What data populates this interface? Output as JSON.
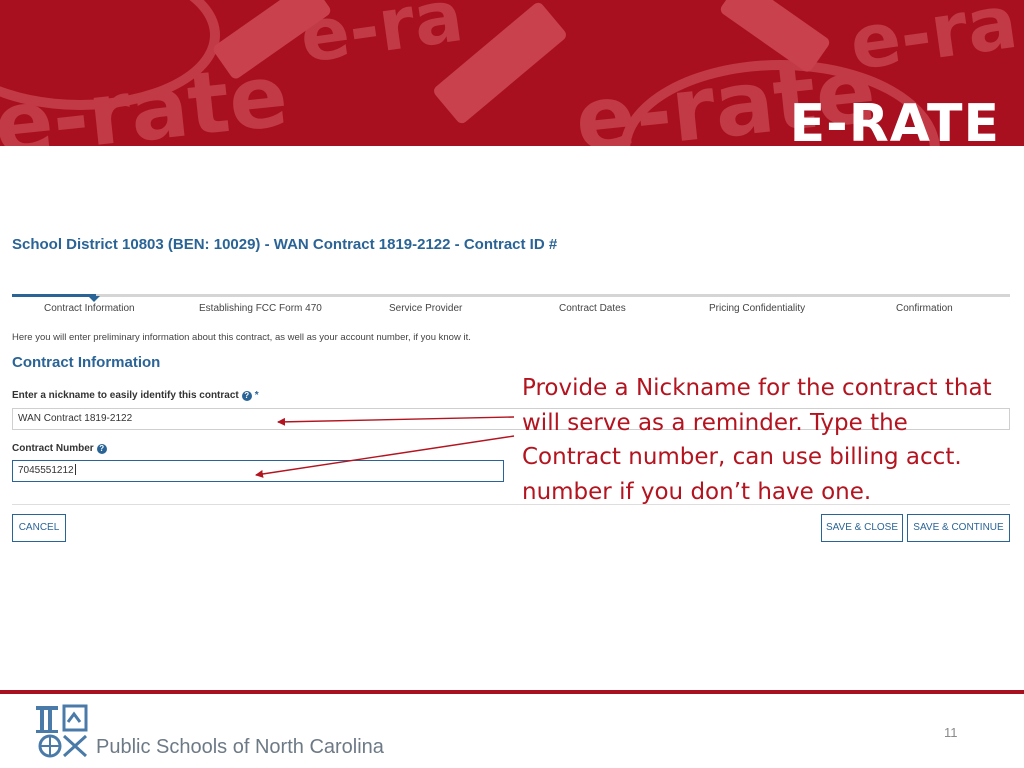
{
  "banner": {
    "brand": "E-RATE",
    "watermarks": [
      "e-rate",
      "e-rate",
      "e-rate",
      "e-ra",
      "e-ra"
    ],
    "colors": {
      "background": "#a8101f",
      "watermark": "#c23a45"
    }
  },
  "page_title": "School District 10803 (BEN: 10029) - WAN Contract 1819-2122 - Contract ID #",
  "stepper": {
    "steps": [
      "Contract Information",
      "Establishing FCC Form 470",
      "Service Provider",
      "Contract Dates",
      "Pricing Confidentiality",
      "Confirmation"
    ],
    "active_index": 0
  },
  "intro_text": "Here you will enter preliminary information about this contract, as well as your account number, if you know it.",
  "section_title": "Contract Information",
  "form": {
    "nickname": {
      "label": "Enter a nickname to easily identify this contract",
      "required_mark": "*",
      "value": "WAN Contract 1819-2122",
      "help_icon": "question-circle-icon"
    },
    "contract_number": {
      "label": "Contract Number",
      "value": "7045551212",
      "help_icon": "question-circle-icon"
    }
  },
  "buttons": {
    "cancel": "CANCEL",
    "save_close": "SAVE & CLOSE",
    "save_continue": "SAVE & CONTINUE"
  },
  "callout": "Provide a Nickname for the contract that will serve as a reminder.  Type the Contract number, can use billing acct. number if you don’t have one.",
  "footer": {
    "org": "Public Schools of North Carolina",
    "page_number": "11"
  },
  "colors": {
    "accent": "#2a6496",
    "callout": "#b3141f",
    "brand_red": "#a8101f"
  }
}
